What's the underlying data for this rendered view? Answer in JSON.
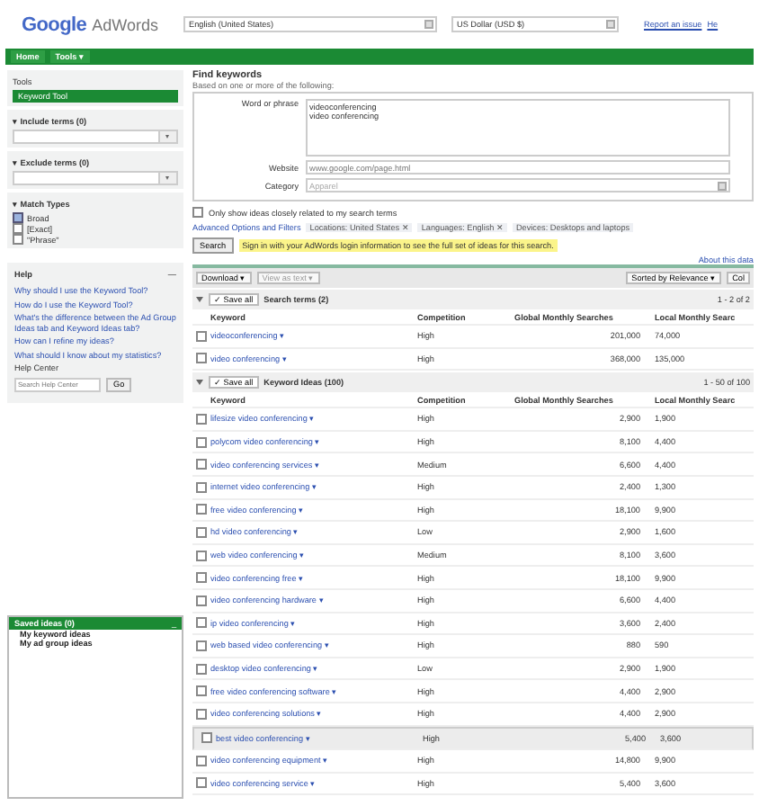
{
  "header": {
    "logo_brand": "Google",
    "logo_product": "AdWords",
    "language_select": "English (United States)",
    "currency_select": "US Dollar (USD $)",
    "links": [
      "Report an issue",
      "He"
    ]
  },
  "nav": [
    {
      "label": "Home",
      "selected": false
    },
    {
      "label": "Tools ▾",
      "selected": false
    }
  ],
  "sidebar": {
    "tools_title": "Tools",
    "tools_items": [
      {
        "label": "Keyword Tool",
        "selected": true
      }
    ],
    "include_terms": {
      "title": "▾ Include terms (0)"
    },
    "exclude_terms": {
      "title": "▾ Exclude terms (0)"
    },
    "match_types": {
      "title": "▾ Match Types",
      "options": [
        {
          "label": "Broad",
          "checked": true
        },
        {
          "label": "[Exact]",
          "checked": false
        },
        {
          "label": "\"Phrase\"",
          "checked": false
        }
      ]
    },
    "help": {
      "title": "Help",
      "collapse": "—",
      "links": [
        "Why should I use the Keyword Tool?",
        "How do I use the Keyword Tool?",
        "What's the difference between the Ad Group Ideas tab and Keyword Ideas tab?",
        "How can I refine my ideas?",
        "What should I know about my statistics?"
      ],
      "help_center": "Help Center",
      "search_placeholder": "Search Help Center",
      "go": "Go"
    },
    "saved": {
      "title": "Saved ideas (0)",
      "collapse": "_",
      "items": [
        "My keyword ideas",
        "My ad group ideas"
      ]
    }
  },
  "find": {
    "title": "Find keywords",
    "subtitle": "Based on one or more of the following:",
    "word_label": "Word or phrase",
    "word_value": "videoconferencing\nvideo conferencing",
    "website_label": "Website",
    "website_placeholder": "www.google.com/page.html",
    "category_label": "Category",
    "category_placeholder": "Apparel",
    "closely_related": {
      "label": "Only show ideas closely related to my search terms",
      "checked": false
    },
    "advanced": "Advanced Options and Filters",
    "filters": [
      "Locations: United States ✕",
      "Languages: English ✕",
      "Devices: Desktops and laptops"
    ],
    "search_button": "Search",
    "signin_notice": "Sign in with your AdWords login information to see the full set of ideas for this search.",
    "about": "About this data"
  },
  "toolbar": {
    "download": "Download ▾",
    "view_as_text": "View as text ▾",
    "sorted": "Sorted by Relevance ▾",
    "columns": "Col"
  },
  "search_terms": {
    "save_all": "✓ Save all",
    "title": "Search terms (2)",
    "pager": "1 - 2 of 2",
    "columns": [
      "Keyword",
      "Competition",
      "Global Monthly Searches",
      "Local Monthly Searc"
    ],
    "rows": [
      {
        "keyword": "videoconferencing ▾",
        "competition": "High",
        "global": "201,000",
        "local": "74,000",
        "checked": false,
        "selected": false
      },
      {
        "keyword": "video conferencing ▾",
        "competition": "High",
        "global": "368,000",
        "local": "135,000",
        "checked": false,
        "selected": false
      }
    ]
  },
  "keyword_ideas": {
    "save_all": "✓ Save all",
    "title": "Keyword Ideas (100)",
    "pager": "1 - 50 of 100",
    "columns": [
      "Keyword",
      "Competition",
      "Global Monthly Searches",
      "Local Monthly Searc"
    ],
    "rows": [
      {
        "keyword": "lifesize video conferencing ▾",
        "competition": "High",
        "global": "2,900",
        "local": "1,900",
        "checked": false,
        "selected": false
      },
      {
        "keyword": "polycom video conferencing ▾",
        "competition": "High",
        "global": "8,100",
        "local": "4,400",
        "checked": false,
        "selected": false
      },
      {
        "keyword": "video conferencing services ▾",
        "competition": "Medium",
        "global": "6,600",
        "local": "4,400",
        "checked": false,
        "selected": false
      },
      {
        "keyword": "internet video conferencing ▾",
        "competition": "High",
        "global": "2,400",
        "local": "1,300",
        "checked": false,
        "selected": false
      },
      {
        "keyword": "free video conferencing ▾",
        "competition": "High",
        "global": "18,100",
        "local": "9,900",
        "checked": false,
        "selected": false
      },
      {
        "keyword": "hd video conferencing ▾",
        "competition": "Low",
        "global": "2,900",
        "local": "1,600",
        "checked": false,
        "selected": false
      },
      {
        "keyword": "web video conferencing ▾",
        "competition": "Medium",
        "global": "8,100",
        "local": "3,600",
        "checked": false,
        "selected": false
      },
      {
        "keyword": "video conferencing free ▾",
        "competition": "High",
        "global": "18,100",
        "local": "9,900",
        "checked": false,
        "selected": false
      },
      {
        "keyword": "video conferencing hardware ▾",
        "competition": "High",
        "global": "6,600",
        "local": "4,400",
        "checked": false,
        "selected": false
      },
      {
        "keyword": "ip video conferencing ▾",
        "competition": "High",
        "global": "3,600",
        "local": "2,400",
        "checked": false,
        "selected": false
      },
      {
        "keyword": "web based video conferencing ▾",
        "competition": "High",
        "global": "880",
        "local": "590",
        "checked": false,
        "selected": false
      },
      {
        "keyword": "desktop video conferencing ▾",
        "competition": "Low",
        "global": "2,900",
        "local": "1,900",
        "checked": false,
        "selected": false
      },
      {
        "keyword": "free video conferencing software ▾",
        "competition": "High",
        "global": "4,400",
        "local": "2,900",
        "checked": false,
        "selected": false
      },
      {
        "keyword": "video conferencing solutions ▾",
        "competition": "High",
        "global": "4,400",
        "local": "2,900",
        "checked": false,
        "selected": false
      },
      {
        "keyword": "best video conferencing ▾",
        "competition": "High",
        "global": "5,400",
        "local": "3,600",
        "checked": false,
        "selected": true
      },
      {
        "keyword": "video conferencing equipment ▾",
        "competition": "High",
        "global": "14,800",
        "local": "9,900",
        "checked": false,
        "selected": false
      },
      {
        "keyword": "video conferencing service ▾",
        "competition": "High",
        "global": "5,400",
        "local": "3,600",
        "checked": false,
        "selected": false
      }
    ]
  }
}
